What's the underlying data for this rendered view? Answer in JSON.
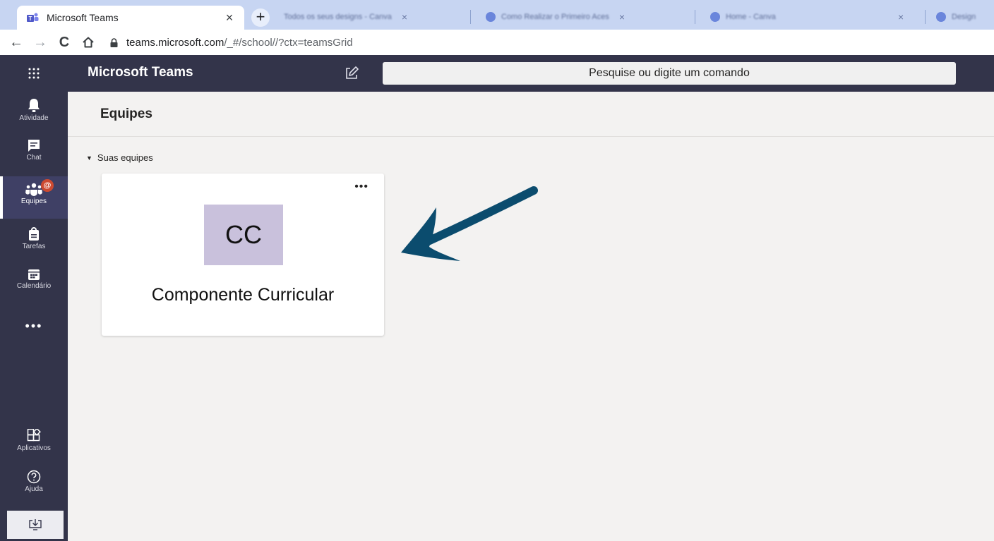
{
  "browser": {
    "active_tab": {
      "title": "Microsoft Teams",
      "close": "×"
    },
    "new_tab": "+",
    "background_tabs": [
      {
        "title": "Todos os seus designs - Canva"
      },
      {
        "title": "Como Realizar o Primeiro Aces"
      },
      {
        "title": "Home - Canva"
      },
      {
        "title": "Design"
      }
    ],
    "nav": {
      "back": "←",
      "forward": "→",
      "reload": "C"
    },
    "url": {
      "host": "teams.microsoft.com",
      "path": "/_#/school//?ctx=teamsGrid"
    }
  },
  "teams": {
    "app_title": "Microsoft Teams",
    "search_placeholder": "Pesquise ou digite um comando"
  },
  "rail": {
    "items": [
      {
        "label": "Atividade",
        "icon": "bell-icon"
      },
      {
        "label": "Chat",
        "icon": "chat-icon"
      },
      {
        "label": "Equipes",
        "icon": "teams-icon",
        "badge": "@",
        "active": true
      },
      {
        "label": "Tarefas",
        "icon": "assignments-icon"
      },
      {
        "label": "Calendário",
        "icon": "calendar-icon"
      }
    ],
    "more": "•••",
    "bottom_items": [
      {
        "label": "Aplicativos",
        "icon": "apps-icon"
      },
      {
        "label": "Ajuda",
        "icon": "help-icon"
      }
    ]
  },
  "main": {
    "title": "Equipes",
    "section": {
      "caret": "▼",
      "label": "Suas equipes"
    },
    "teams": [
      {
        "initials": "CC",
        "name": "Componente Curricular",
        "more": "•••",
        "avatar_color": "#c9c1dc"
      }
    ]
  },
  "colors": {
    "rail_bg": "#33344a",
    "content_bg": "#f3f2f1",
    "tabstrip_bg": "#c7d5f2",
    "arrow": "#0b4c6e",
    "badge": "#cc4a31"
  }
}
